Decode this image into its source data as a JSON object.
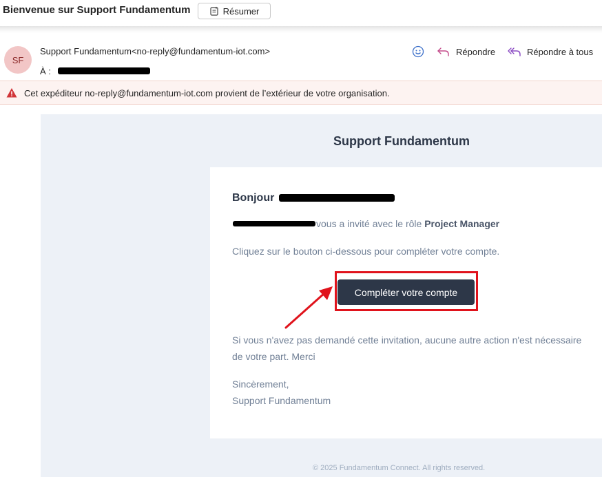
{
  "title_bar": {
    "subject": "Bienvenue sur Support Fundamentum",
    "summarize_label": "Résumer",
    "summarize_icon": "summary-icon"
  },
  "header": {
    "avatar_initials": "SF",
    "avatar_color": "#f2c6c6",
    "sender": "Support Fundamentum<no-reply@fundamentum-iot.com>",
    "to_label": "À :",
    "emoji_icon": "emoji-icon",
    "reply_label": "Répondre",
    "reply_all_label": "Répondre à tous",
    "reply_icon_color": "#c34a8a"
  },
  "warning": {
    "text": "Cet expéditeur no-reply@fundamentum-iot.com provient de l’extérieur de votre organisation.",
    "icon": "warning-icon",
    "icon_color": "#d13438"
  },
  "email": {
    "brand": "Support Fundamentum",
    "greeting": "Bonjour",
    "invite_text": "vous a invité avec le rôle",
    "role": "Project Manager",
    "instruction": "Cliquez sur le bouton ci-dessous pour compléter votre compte.",
    "cta_label": "Compléter votre compte",
    "cta_color": "#2d3748",
    "highlight_color": "#e0131c",
    "disclaimer": "Si vous n'avez pas demandé cette invitation, aucune autre action n'est nécessaire de votre part. Merci",
    "signoff_1": "Sincèrement,",
    "signoff_2": "Support Fundamentum",
    "footer": "© 2025 Fundamentum Connect. All rights reserved."
  }
}
